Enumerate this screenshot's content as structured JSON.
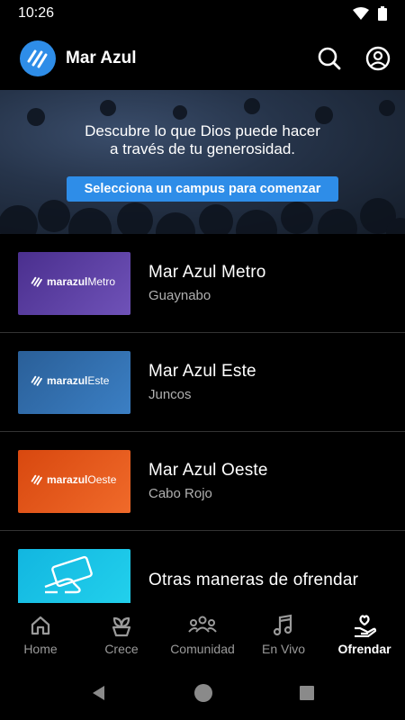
{
  "status": {
    "time": "10:26"
  },
  "app": {
    "title": "Mar Azul"
  },
  "hero": {
    "line1": "Descubre lo que Dios puede hacer",
    "line2": "a través de tu generosidad.",
    "button_label": "Selecciona un campus para comenzar"
  },
  "campuses": [
    {
      "thumb_brand": "marazul",
      "thumb_suffix": "Metro",
      "title": "Mar Azul Metro",
      "subtitle": "Guaynabo",
      "color": "#5b3d9e"
    },
    {
      "thumb_brand": "marazul",
      "thumb_suffix": "Este",
      "title": "Mar Azul Este",
      "subtitle": "Juncos",
      "color": "#2f6fb0"
    },
    {
      "thumb_brand": "marazul",
      "thumb_suffix": "Oeste",
      "title": "Mar Azul Oeste",
      "subtitle": "Cabo Rojo",
      "color": "#e8541a"
    }
  ],
  "other": {
    "title": "Otras  maneras de ofrendar",
    "color": "#18c3e6"
  },
  "nav": {
    "items": [
      {
        "label": "Home",
        "icon": "home-icon"
      },
      {
        "label": "Crece",
        "icon": "sprout-icon"
      },
      {
        "label": "Comunidad",
        "icon": "community-icon"
      },
      {
        "label": "En Vivo",
        "icon": "music-icon"
      },
      {
        "label": "Ofrendar",
        "icon": "give-hand-icon",
        "active": true
      }
    ]
  },
  "colors": {
    "accent": "#2e8de8",
    "background": "#000000"
  }
}
